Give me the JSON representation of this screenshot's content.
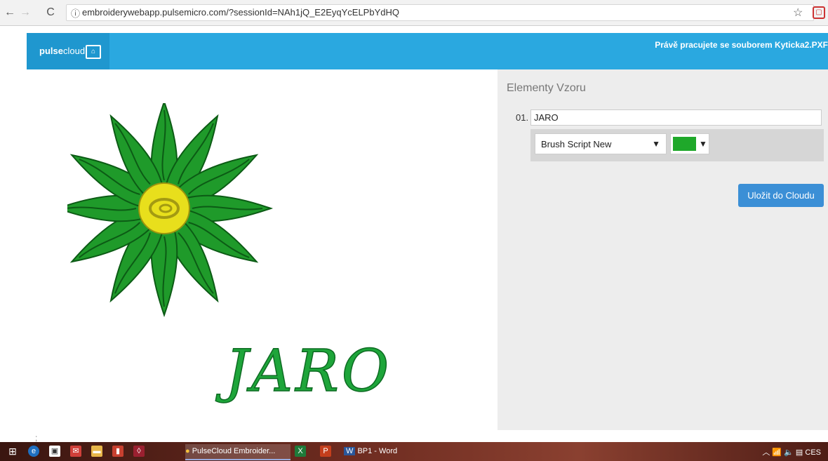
{
  "browser": {
    "url": "embroiderywebapp.pulsemicro.com/?sessionId=NAh1jQ_E2EyqYcELPbYdHQ"
  },
  "header": {
    "logo_bold": "pulse",
    "logo_light": "cloud",
    "working_file": "Právě pracujete se souborem Kyticka2.PXF"
  },
  "design": {
    "text": "JARO",
    "colors": {
      "leaf": "#1f9a2a",
      "leaf_dark": "#0c5b15",
      "center": "#e8df1c",
      "lettering": "#1ea53a"
    }
  },
  "panel": {
    "title": "Elementy Vzoru",
    "element_number": "01.",
    "element_text": "JARO",
    "font_value": "Brush Script New",
    "color_value": "#1fa82a",
    "save_label": "Uložit do Cloudu"
  },
  "taskbar": {
    "tasks": [
      "PulseCloud Embroider...",
      "BP1 - Word"
    ],
    "tray_lang": "CES"
  }
}
